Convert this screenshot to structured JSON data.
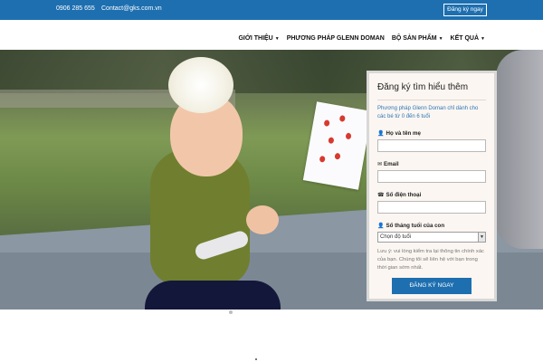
{
  "topbar": {
    "phone": "0906 285 655",
    "email": "Contact@gks.com.vn",
    "register_button": "Đăng ký ngay"
  },
  "nav": {
    "items": [
      {
        "label": "GIỚI THIỆU",
        "has_dropdown": true
      },
      {
        "label": "PHƯƠNG PHÁP GLENN DOMAN",
        "has_dropdown": false
      },
      {
        "label": "BỘ SẢN PHẨM",
        "has_dropdown": true
      },
      {
        "label": "KẾT QUẢ",
        "has_dropdown": true
      }
    ]
  },
  "form": {
    "title": "Đăng ký tìm hiểu thêm",
    "description": "Phương pháp Glenn Doman chỉ dành cho các bé từ 0 đến 6 tuổi",
    "fields": [
      {
        "label": "Họ và tên mẹ",
        "icon": "user-icon",
        "value": ""
      },
      {
        "label": "Email",
        "icon": "envelope-icon",
        "value": ""
      },
      {
        "label": "Số điện thoại",
        "icon": "phone-icon",
        "value": ""
      },
      {
        "label": "Số tháng tuổi của con",
        "icon": "user-icon",
        "selected": "Chọn độ tuổi"
      }
    ],
    "note": "Lưu ý: vui lòng kiểm tra lại thông tin chính xác của bạn. Chúng tôi sẽ liên hệ với bạn trong thời gian sớm nhất.",
    "submit": "ĐĂNG KÝ NGAY"
  },
  "colors": {
    "brand_blue": "#1d6fb0",
    "link_blue": "#2d75b7",
    "form_bg": "#fbf6f1"
  }
}
